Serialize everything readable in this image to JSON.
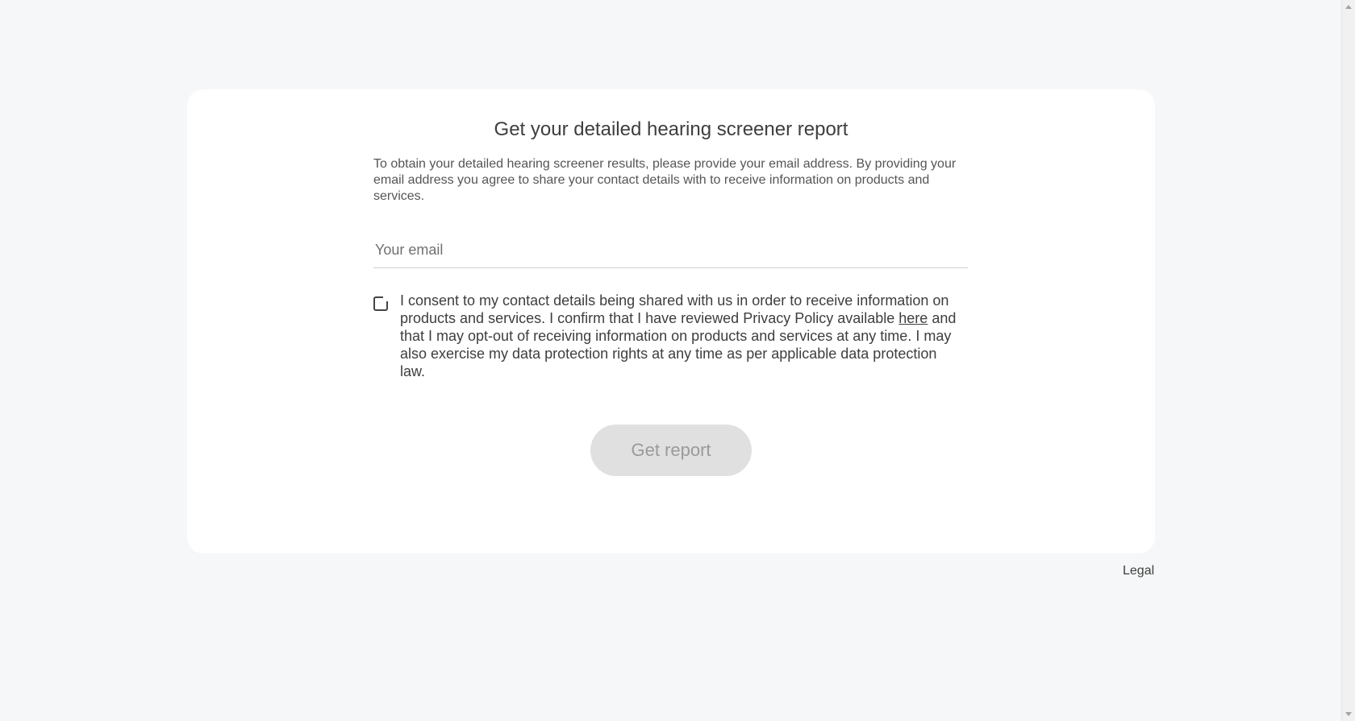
{
  "report": {
    "title": "Get your detailed hearing screener report",
    "intro": "To obtain your detailed hearing screener results, please provide your email address. By providing your email address you agree to share your contact details with to receive information on products and services."
  },
  "email": {
    "placeholder": "Your email",
    "value": ""
  },
  "consent": {
    "checked": false,
    "text_before_link": "I consent to my contact details being shared with us in order to receive information on products and services. I confirm that I have reviewed Privacy Policy available ",
    "link_label": "here",
    "text_after_link": " and that I may opt-out of receiving information on products and services at any time. I may also exercise my data protection rights at any time as per applicable data protection law."
  },
  "actions": {
    "get_report_label": "Get report",
    "get_report_enabled": false
  },
  "footer": {
    "legal_label": "Legal"
  },
  "colors": {
    "page_background": "#f6f7f9",
    "card_background": "#ffffff",
    "button_disabled_background": "#e0e0e0",
    "button_disabled_text": "#9a9a9a",
    "text": "#3e3e3e"
  }
}
